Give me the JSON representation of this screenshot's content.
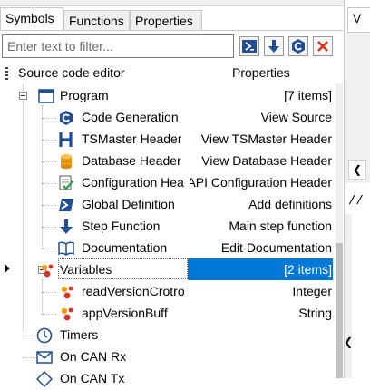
{
  "tabs": [
    "Symbols",
    "Functions",
    "Properties"
  ],
  "filter": {
    "placeholder": "Enter text to filter..."
  },
  "header": {
    "col1": "Source code editor",
    "col2": "Properties"
  },
  "tree": [
    {
      "label": "Program",
      "value": "[7 items]",
      "icon": "window-icon"
    },
    {
      "label": "Code Generation",
      "value": "View Source",
      "icon": "code-c-icon"
    },
    {
      "label": "TSMaster Header",
      "value": "View TSMaster Header",
      "icon": "header-h-icon"
    },
    {
      "label": "Database Header",
      "value": "View Database Header",
      "icon": "database-icon"
    },
    {
      "label": "Configuration Hea",
      "value": "Edit API Configuration Header",
      "icon": "config-check-icon"
    },
    {
      "label": "Global Definition",
      "value": "Add definitions",
      "icon": "powershell-icon"
    },
    {
      "label": "Step Function",
      "value": "Main step function",
      "icon": "arrow-down-icon"
    },
    {
      "label": "Documentation",
      "value": "Edit Documentation",
      "icon": "book-icon"
    },
    {
      "label": "Variables",
      "value": "[2 items]",
      "icon": "variables-dots-icon"
    },
    {
      "label": "readVersionCrotro",
      "value": "Integer",
      "icon": "variable-dots-icon"
    },
    {
      "label": "appVersionBuff",
      "value": "String",
      "icon": "variable-dots-icon"
    },
    {
      "label": "Timers",
      "value": "",
      "icon": "clock-icon"
    },
    {
      "label": "On CAN Rx",
      "value": "",
      "icon": "envelope-icon"
    },
    {
      "label": "On CAN Tx",
      "value": "",
      "icon": "send-icon"
    }
  ],
  "right_pane": {
    "tab_label": "V",
    "code_text": "//"
  },
  "colors": {
    "selection": "#0078d7",
    "orange": "#f39c12",
    "red": "#d93025",
    "blue": "#1f4e96"
  }
}
